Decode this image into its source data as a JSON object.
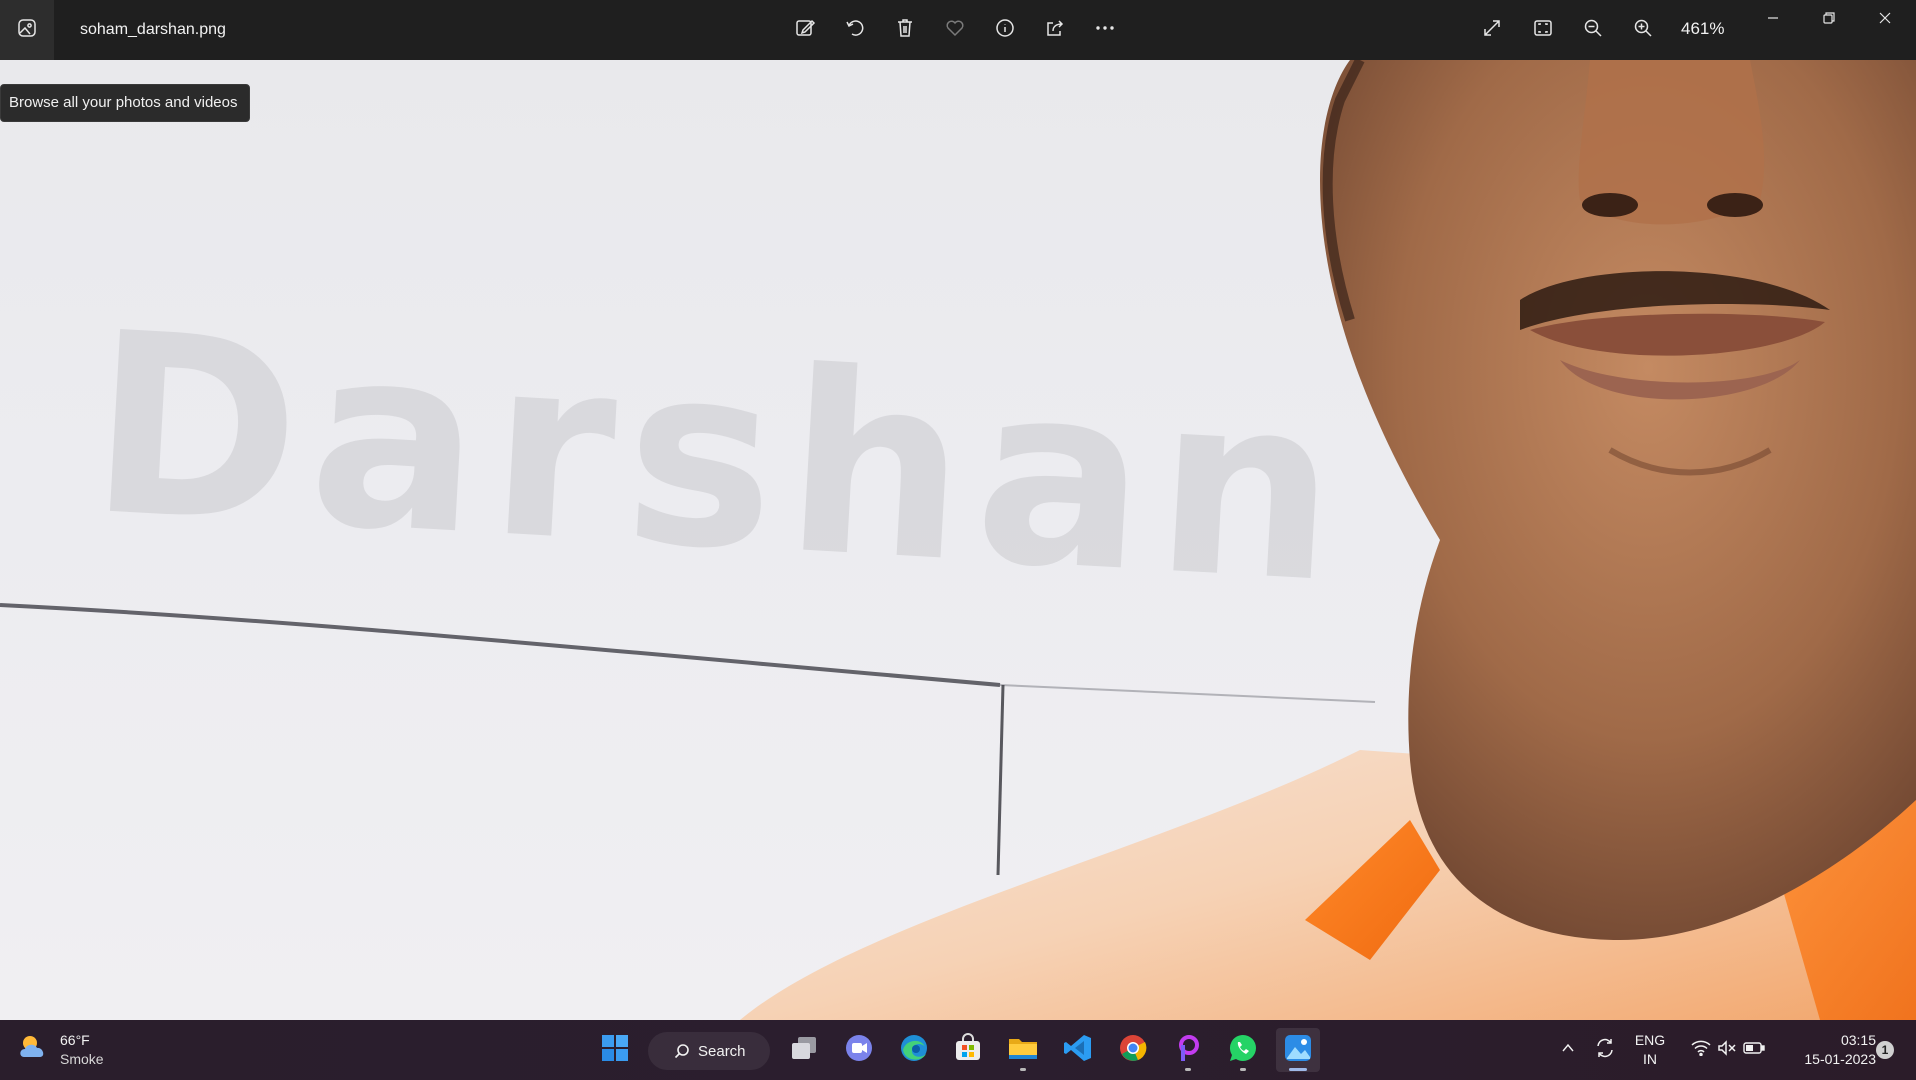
{
  "window": {
    "file_name": "soham_darshan.png",
    "zoom_level": "461%"
  },
  "tooltip": {
    "text": "Browse all your photos and videos"
  },
  "photo": {
    "visible_text": "Darshan"
  },
  "toolbar": {
    "edit": "edit-icon",
    "rotate": "rotate-icon",
    "delete": "trash-icon",
    "favorite": "heart-icon",
    "info": "info-icon",
    "share": "share-icon",
    "more": "more-icon",
    "fullscreen": "expand-icon",
    "fit": "fit-to-window-icon",
    "zoom_out": "zoom-out-icon",
    "zoom_in": "zoom-in-icon"
  },
  "taskbar": {
    "weather": {
      "temperature": "66°F",
      "condition": "Smoke"
    },
    "search_label": "Search",
    "apps": [
      "start",
      "task-view",
      "teams-chat",
      "edge",
      "store",
      "file-explorer",
      "vscode",
      "chrome",
      "picsart",
      "whatsapp",
      "photos"
    ],
    "language": {
      "line1": "ENG",
      "line2": "IN"
    },
    "clock": {
      "time": "03:15",
      "date": "15-01-2023"
    },
    "notification_count": "1"
  },
  "colors": {
    "titlebar": "#1f1f1f",
    "taskbar": "#2a1e2c",
    "accent": "#0078d4"
  }
}
